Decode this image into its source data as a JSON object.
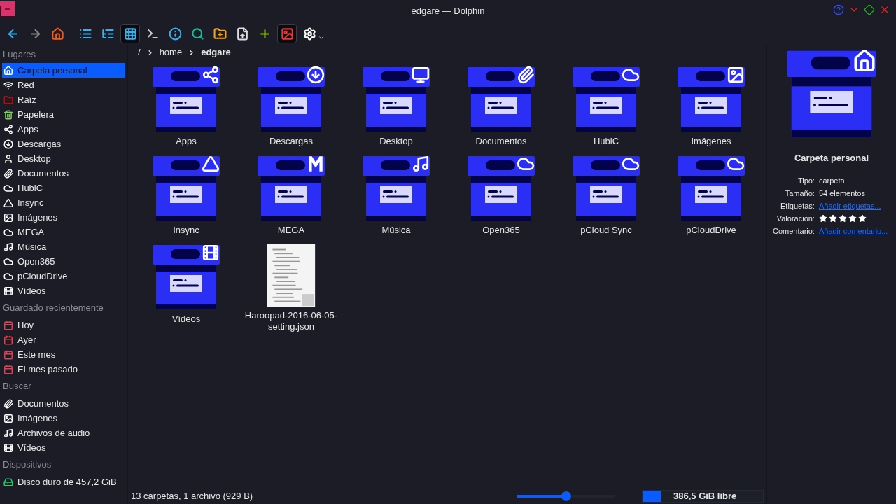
{
  "window": {
    "title": "edgare — Dolphin"
  },
  "toolbar": [
    {
      "kind": "back",
      "selected": false,
      "disabled": false
    },
    {
      "kind": "forward",
      "selected": false,
      "disabled": true
    },
    {
      "kind": "home",
      "selected": false,
      "disabled": false
    },
    {
      "kind": "details",
      "selected": false,
      "disabled": false
    },
    {
      "kind": "tree",
      "selected": false,
      "disabled": false
    },
    {
      "kind": "icons",
      "selected": true,
      "disabled": false
    },
    {
      "kind": "terminal",
      "selected": false,
      "disabled": false
    },
    {
      "kind": "info",
      "selected": false,
      "disabled": false
    },
    {
      "kind": "search",
      "selected": false,
      "disabled": false
    },
    {
      "kind": "newfolder",
      "selected": false,
      "disabled": false
    },
    {
      "kind": "newfile",
      "selected": false,
      "disabled": false
    },
    {
      "kind": "add",
      "selected": false,
      "disabled": false
    },
    {
      "kind": "preview",
      "selected": true,
      "disabled": false
    },
    {
      "kind": "settings",
      "selected": false,
      "disabled": false
    }
  ],
  "breadcrumb": [
    "/",
    "home",
    "edgare"
  ],
  "sidebar": [
    {
      "heading": "Lugares",
      "items": [
        {
          "label": "Carpeta personal",
          "kind": "home",
          "selected": true
        },
        {
          "label": "Red",
          "kind": "wifi",
          "selected": false
        },
        {
          "label": "Raíz",
          "kind": "root",
          "selected": false
        },
        {
          "label": "Papelera",
          "kind": "trash",
          "selected": false
        },
        {
          "label": "Apps",
          "kind": "apps",
          "selected": false
        },
        {
          "label": "Descargas",
          "kind": "download",
          "selected": false
        },
        {
          "label": "Desktop",
          "kind": "user",
          "selected": false
        },
        {
          "label": "Documentos",
          "kind": "clip",
          "selected": false
        },
        {
          "label": "HubiC",
          "kind": "cloud",
          "selected": false
        },
        {
          "label": "Insync",
          "kind": "drive",
          "selected": false
        },
        {
          "label": "Imágenes",
          "kind": "image",
          "selected": false
        },
        {
          "label": "MEGA",
          "kind": "cloud",
          "selected": false
        },
        {
          "label": "Música",
          "kind": "music",
          "selected": false
        },
        {
          "label": "Open365",
          "kind": "cloud",
          "selected": false
        },
        {
          "label": "pCloudDrive",
          "kind": "cloud",
          "selected": false
        },
        {
          "label": "Vídeos",
          "kind": "film",
          "selected": false
        }
      ]
    },
    {
      "heading": "Guardado recientemente",
      "items": [
        {
          "label": "Hoy",
          "kind": "calday",
          "selected": false
        },
        {
          "label": "Ayer",
          "kind": "calday",
          "selected": false
        },
        {
          "label": "Este mes",
          "kind": "calmonth",
          "selected": false
        },
        {
          "label": "El mes pasado",
          "kind": "calmonth",
          "selected": false
        }
      ]
    },
    {
      "heading": "Buscar",
      "items": [
        {
          "label": "Documentos",
          "kind": "clip",
          "selected": false
        },
        {
          "label": "Imágenes",
          "kind": "image",
          "selected": false
        },
        {
          "label": "Archivos de audio",
          "kind": "note",
          "selected": false
        },
        {
          "label": "Vídeos",
          "kind": "film",
          "selected": false
        }
      ]
    },
    {
      "heading": "Dispositivos",
      "items": [
        {
          "label": "Disco duro de 457,2 GiB",
          "kind": "disk",
          "selected": false
        }
      ]
    }
  ],
  "files": [
    {
      "name": "Apps",
      "kind": "apps"
    },
    {
      "name": "Descargas",
      "kind": "download"
    },
    {
      "name": "Desktop",
      "kind": "desktop"
    },
    {
      "name": "Documentos",
      "kind": "clip"
    },
    {
      "name": "HubiC",
      "kind": "cloud"
    },
    {
      "name": "Imágenes",
      "kind": "image"
    },
    {
      "name": "Insync",
      "kind": "drive"
    },
    {
      "name": "MEGA",
      "kind": "mega"
    },
    {
      "name": "Música",
      "kind": "music"
    },
    {
      "name": "Open365",
      "kind": "cloud"
    },
    {
      "name": "pCloud Sync",
      "kind": "cloud"
    },
    {
      "name": "pCloudDrive",
      "kind": "cloud"
    },
    {
      "name": "Vídeos",
      "kind": "film"
    },
    {
      "name": "Haroopad-2016-06-05-setting.json",
      "kind": "document"
    }
  ],
  "info": {
    "title": "Carpeta personal",
    "fields": [
      {
        "label": "Tipo:",
        "kind": "text",
        "value": "carpeta"
      },
      {
        "label": "Tamaño:",
        "kind": "text",
        "value": "54 elementos"
      },
      {
        "label": "Etiquetas:",
        "kind": "link",
        "value": "Añadir etiquetas..."
      },
      {
        "label": "Valoración:",
        "kind": "rating",
        "stars": 5
      },
      {
        "label": "Comentario:",
        "kind": "link",
        "value": "Añadir comentario..."
      }
    ]
  },
  "status_bar": {
    "text": "13 carpetas, 1 archivo (929 B)",
    "zoom": {
      "level": 0.5
    },
    "space": {
      "level": 0.15,
      "text": "386,5 GiB libre"
    }
  }
}
